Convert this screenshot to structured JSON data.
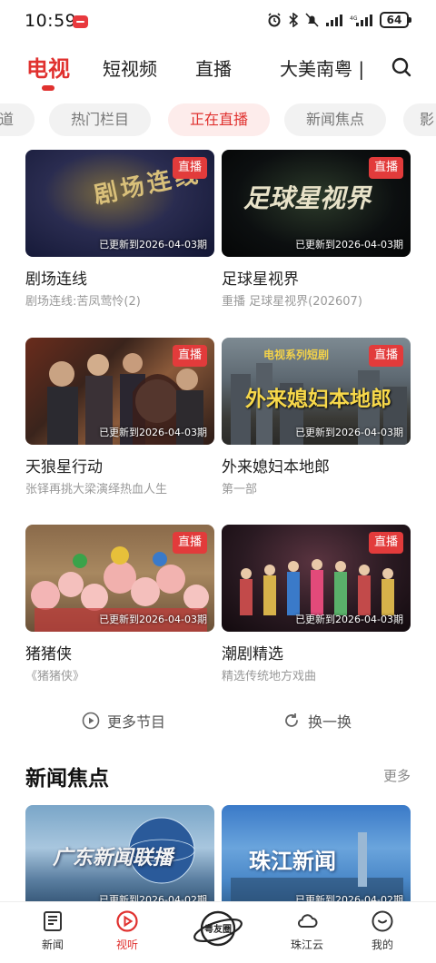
{
  "status_bar": {
    "time": "10:59",
    "battery": "64"
  },
  "top_nav": {
    "tabs": [
      {
        "label": "电视",
        "active": true
      },
      {
        "label": "短视频",
        "active": false
      },
      {
        "label": "直播",
        "active": false
      },
      {
        "label": "大美南粤 |",
        "active": false
      }
    ]
  },
  "chips": [
    {
      "label": "道",
      "active": false
    },
    {
      "label": "热门栏目",
      "active": false
    },
    {
      "label": "正在直播",
      "active": true
    },
    {
      "label": "新闻焦点",
      "active": false
    },
    {
      "label": "影",
      "active": false
    }
  ],
  "programs": [
    {
      "title": "剧场连线",
      "subtitle": "剧场连线:苦凤莺怜(2)",
      "badge": "直播",
      "update": "已更新到2026-04-03期",
      "art": "剧场连线"
    },
    {
      "title": "足球星视界",
      "subtitle": "重播 足球星视界(202607)",
      "badge": "直播",
      "update": "已更新到2026-04-03期",
      "art": "足球星视界"
    },
    {
      "title": "天狼星行动",
      "subtitle": "张铎再挑大梁演绎热血人生",
      "badge": "直播",
      "update": "已更新到2026-04-03期",
      "art": ""
    },
    {
      "title": "外来媳妇本地郎",
      "subtitle": "第一部",
      "badge": "直播",
      "update": "已更新到2026-04-03期",
      "art": "外来媳妇本地郎",
      "art_top": "电视系列短剧"
    },
    {
      "title": "猪猪侠",
      "subtitle": "《猪猪侠》",
      "badge": "直播",
      "update": "已更新到2026-04-03期",
      "art": ""
    },
    {
      "title": "潮剧精选",
      "subtitle": "精选传统地方戏曲",
      "badge": "直播",
      "update": "已更新到2026-04-03期",
      "art": ""
    }
  ],
  "actions": {
    "more": "更多节目",
    "refresh": "换一换"
  },
  "news_section": {
    "title": "新闻焦点",
    "more": "更多",
    "items": [
      {
        "art": "广东新闻联播",
        "update": "已更新到2026-04-02期"
      },
      {
        "art": "珠江新闻",
        "update": "已更新到2026-04-02期"
      }
    ]
  },
  "bottom_nav": {
    "items": [
      {
        "label": "新闻",
        "active": false
      },
      {
        "label": "视听",
        "active": true
      },
      {
        "label": "粤友圈",
        "active": false
      },
      {
        "label": "珠江云",
        "active": false
      },
      {
        "label": "我的",
        "active": false
      }
    ]
  },
  "colors": {
    "accent": "#e0312f",
    "chip_bg": "#f2f2f2",
    "live_badge": "#e23b3b"
  }
}
